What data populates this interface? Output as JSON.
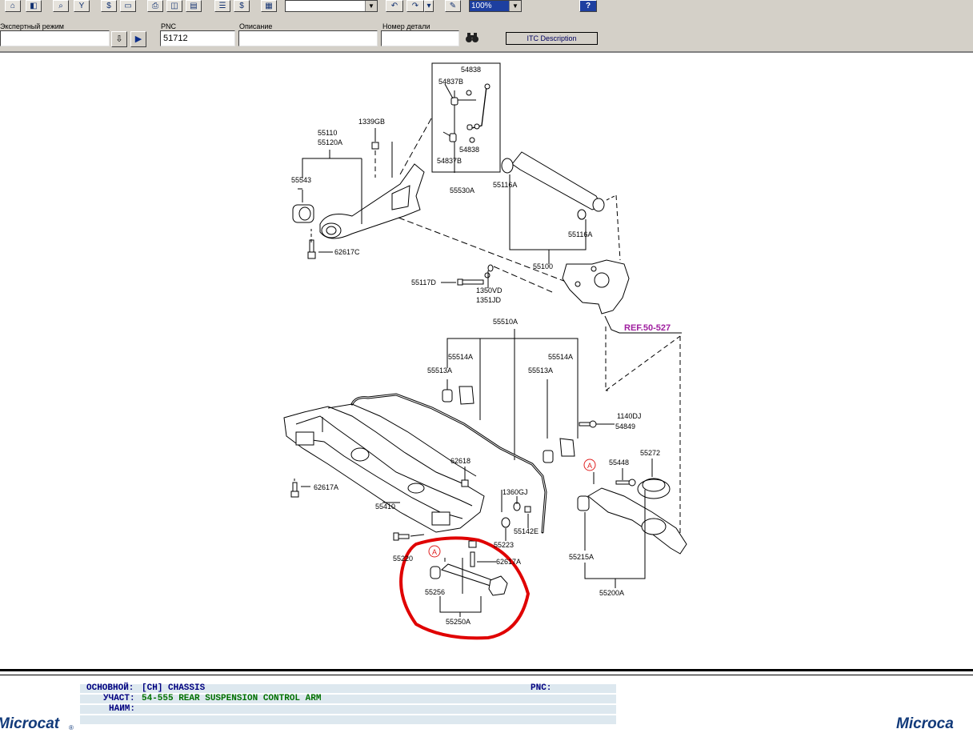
{
  "toolbar": {
    "search_mode_label": "Экспертный режим",
    "pnc_label": "PNC",
    "pnc_value": "51712",
    "description_label": "Описание",
    "description_value": "",
    "part_number_label": "Номер детали",
    "part_number_value": "",
    "itc_button_label": "ITC Description",
    "zoom_value": "100%",
    "help_label": "?"
  },
  "callouts": {
    "c54838a": "54838",
    "c54837b_a": "54837B",
    "c54838b": "54838",
    "c54837b_b": "54837B",
    "c55530a": "55530A",
    "c1339gb": "1339GB",
    "c55110": "55110",
    "c55120a": "55120A",
    "c55543": "55543",
    "c62617c": "62617C",
    "c55116a_1": "55116A",
    "c55116a_2": "55116A",
    "c55100": "55100",
    "c55117d": "55117D",
    "c1350vd": "1350VD",
    "c1351jd": "1351JD",
    "ref": "REF.50-527",
    "c55510a": "55510A",
    "c55514a_1": "55514A",
    "c55514a_2": "55514A",
    "c55513a_1": "55513A",
    "c55513a_2": "55513A",
    "c1140dj": "1140DJ",
    "c54849": "54849",
    "c62618": "62618",
    "c62617a_1": "62617A",
    "c55410": "55410",
    "c1360gj": "1360GJ",
    "c55142e": "55142E",
    "c55223": "55223",
    "c55220": "55220",
    "c62617a_2": "62617A",
    "c55256": "55256",
    "c55250a": "55250A",
    "marker_a_1": "A",
    "marker_a_2": "A",
    "c55448": "55448",
    "c55272": "55272",
    "c55215a": "55215A",
    "c55200a": "55200A"
  },
  "info": {
    "main_label": "ОСНОВНОЙ:",
    "main_value": "[CH]  CHASSIS",
    "section_label": "УЧАСТ:",
    "section_value": "54-555  REAR SUSPENSION CONTROL ARM",
    "name_label": "НАИМ:",
    "name_value": "",
    "pnc_label": "PNC:",
    "pnc_value": ""
  },
  "brand": {
    "left": "Microcat",
    "right": "Microca"
  },
  "colors": {
    "highlight": "#e00000",
    "ref_text": "#a020a0",
    "marker": "#e02020"
  }
}
